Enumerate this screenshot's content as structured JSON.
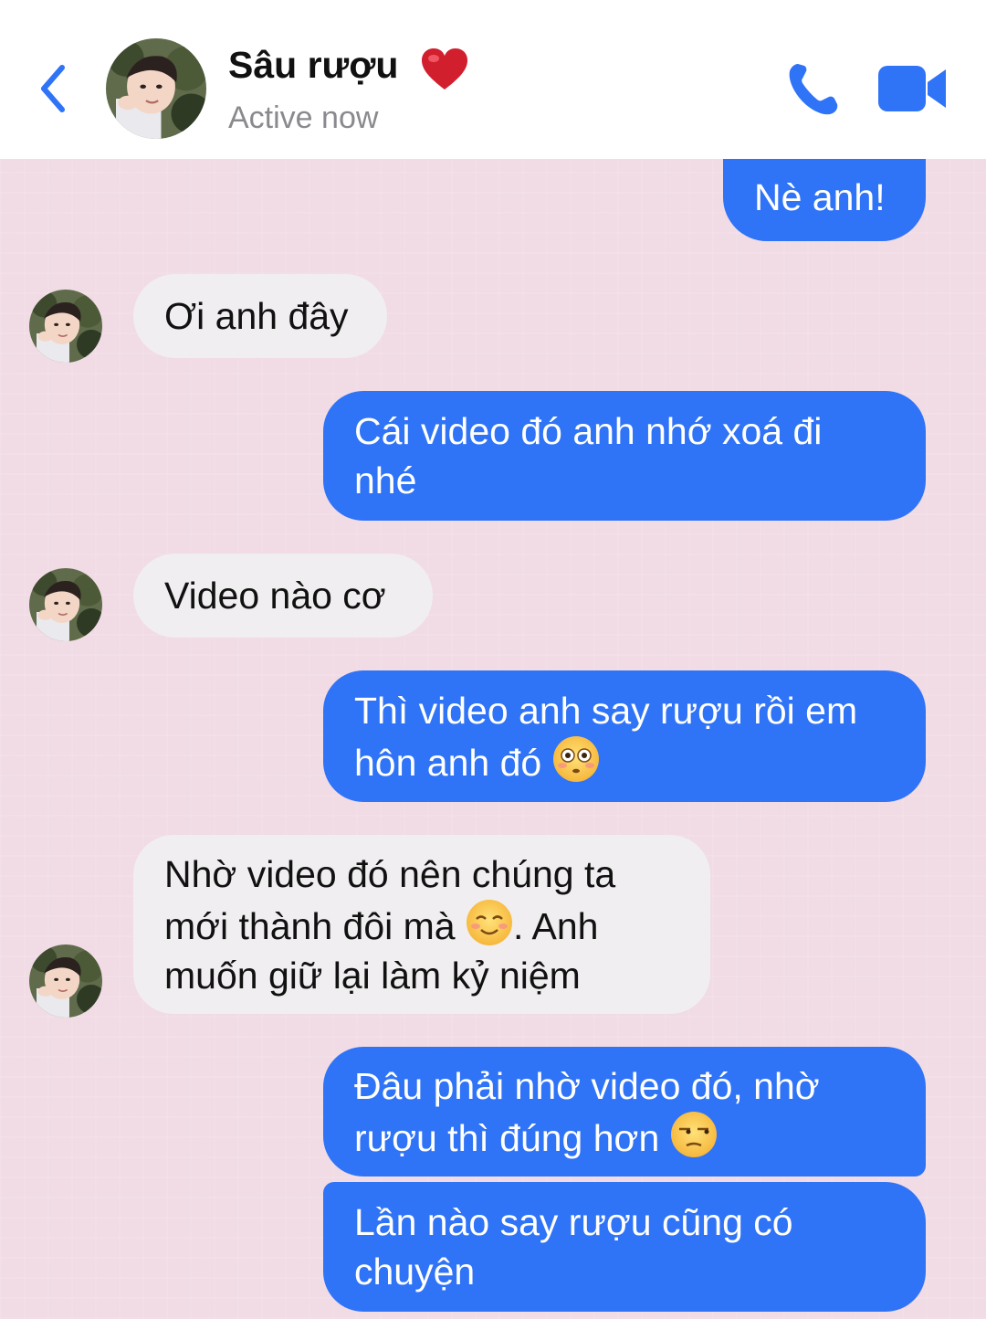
{
  "header": {
    "contact_name": "Sâu rượu",
    "heart_emoji": "❤️",
    "status": "Active now",
    "icons": [
      "back-chevron-icon",
      "avatar",
      "heart-icon",
      "phone-icon",
      "video-camera-icon"
    ],
    "accent_color": "#2f73f7"
  },
  "messages": [
    {
      "sender": "me",
      "text": "Nè anh!"
    },
    {
      "sender": "them",
      "text": "Ơi anh đây"
    },
    {
      "sender": "me",
      "text": "Cái video đó anh nhớ xoá đi nhé"
    },
    {
      "sender": "them",
      "text": "Video nào cơ"
    },
    {
      "sender": "me",
      "text": "Thì video anh say rượu rồi em hôn anh đó",
      "emoji": "flushed-face-icon"
    },
    {
      "sender": "them",
      "text_before": "Nhờ video đó nên chúng ta mới thành đôi mà",
      "emoji": "smiling-face-icon",
      "text_after": ". Anh muốn giữ lại làm kỷ niệm"
    },
    {
      "sender": "me",
      "text": "Đâu phải nhờ video đó, nhờ rượu thì đúng hơn",
      "emoji": "unamused-face-icon"
    },
    {
      "sender": "me",
      "text": "Lần nào say rượu cũng có chuyện"
    }
  ],
  "colors": {
    "background": "#f1dbe5",
    "outgoing_bubble": "#2f73f7",
    "incoming_bubble": "#f0eef0"
  }
}
